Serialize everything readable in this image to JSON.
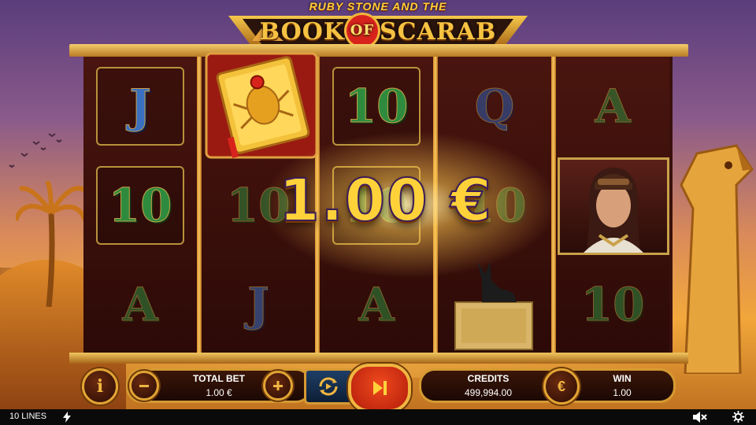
{
  "game": {
    "title_small": "RUBY STONE AND THE",
    "title_word1": "BOOK",
    "title_of": "OF",
    "title_word2": "SCARAB"
  },
  "reels": {
    "symbols": [
      [
        "J",
        "10",
        "wild-A"
      ],
      [
        "book-scatter",
        "10",
        "J"
      ],
      [
        "10",
        "10",
        "A"
      ],
      [
        "Q",
        "10",
        "anubis"
      ],
      [
        "A",
        "woman",
        "10"
      ]
    ]
  },
  "win_display": {
    "amount": "1.00 €"
  },
  "controls": {
    "info_label": "i",
    "total_bet_label": "TOTAL BET",
    "total_bet_value": "1.00 €",
    "credits_label": "CREDITS",
    "credits_value": "499,994.00",
    "currency_symbol": "€",
    "win_label": "WIN",
    "win_value": "1.00"
  },
  "status_bar": {
    "lines_text": "10 LINES",
    "icons": [
      "lightning-icon",
      "speaker-muted-icon",
      "gear-icon"
    ]
  },
  "colors": {
    "gold": "#f0b640",
    "spin_red": "#d8231d",
    "reel_bg": "#3a100c"
  }
}
